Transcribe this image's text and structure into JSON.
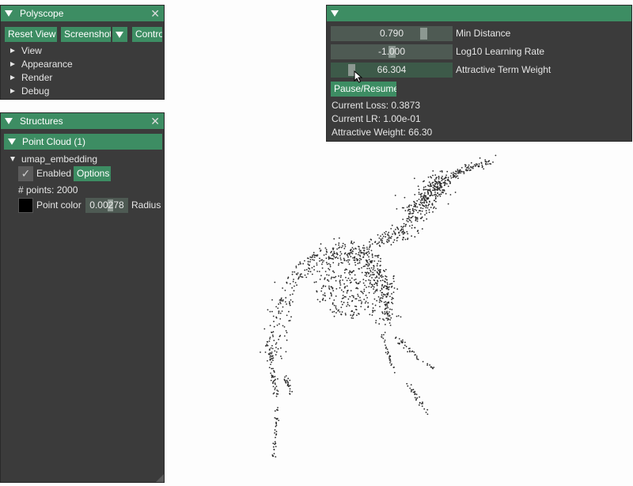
{
  "polyscope": {
    "title": "Polyscope",
    "close": "✕",
    "buttons": {
      "reset_view": "Reset View",
      "screenshot": "Screenshot",
      "controls": "Controls"
    },
    "tree": [
      "View",
      "Appearance",
      "Render",
      "Debug"
    ]
  },
  "structures": {
    "title": "Structures",
    "close": "✕",
    "group": "Point Cloud (1)",
    "item": "umap_embedding",
    "enabled_label": "Enabled",
    "enabled_check": "✓",
    "options_label": "Options",
    "points": "# points: 2000",
    "point_color_label": "Point color",
    "point_color": "#000000",
    "radius_value": "0.00278",
    "radius_label": "Radius"
  },
  "controls": {
    "sliders": [
      {
        "value": "0.790",
        "label": "Min Distance",
        "level": 0.78
      },
      {
        "value": "-1.000",
        "label": "Log10 Learning Rate",
        "level": 0.5
      },
      {
        "value": "66.304",
        "label": "Attractive Term Weight",
        "level": 0.15
      }
    ],
    "pause_resume": "Pause/Resume",
    "current_loss": "Current Loss: 0.3873",
    "current_lr": "Current LR: 1.00e-01",
    "attractive_weight": "Attractive Weight: 66.30"
  },
  "colors": {
    "accent": "#3d8d63",
    "panel_bg": "#3b3b3b",
    "canvas_bg": "#fdfdfd",
    "points": "#2a2a2a"
  }
}
